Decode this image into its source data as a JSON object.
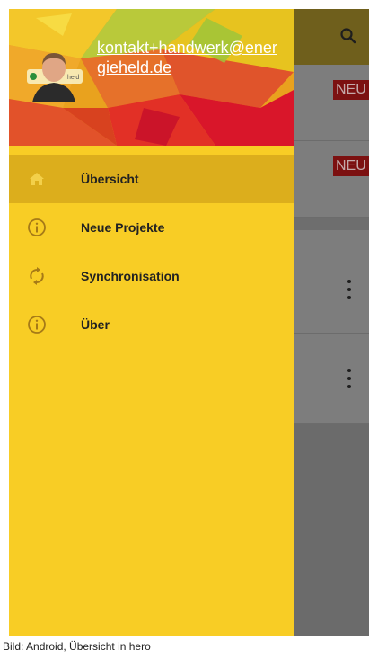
{
  "background_app": {
    "badge_1": "NEU",
    "badge_2": "NEU"
  },
  "drawer": {
    "account_email": "kontakt+handwerk@energieheld.de",
    "logo_text": "heid",
    "nav": [
      {
        "label": "Übersicht",
        "icon": "home-icon",
        "active": true
      },
      {
        "label": "Neue Projekte",
        "icon": "info-icon",
        "active": false
      },
      {
        "label": "Synchronisation",
        "icon": "sync-icon",
        "active": false
      },
      {
        "label": "Über",
        "icon": "info-icon",
        "active": false
      }
    ]
  },
  "caption": "Bild: Android, Übersicht in hero",
  "colors": {
    "drawer": "#f8cd25",
    "active_item": "#dcae1c",
    "icon": "#a67a17",
    "badge": "#7c1111"
  }
}
